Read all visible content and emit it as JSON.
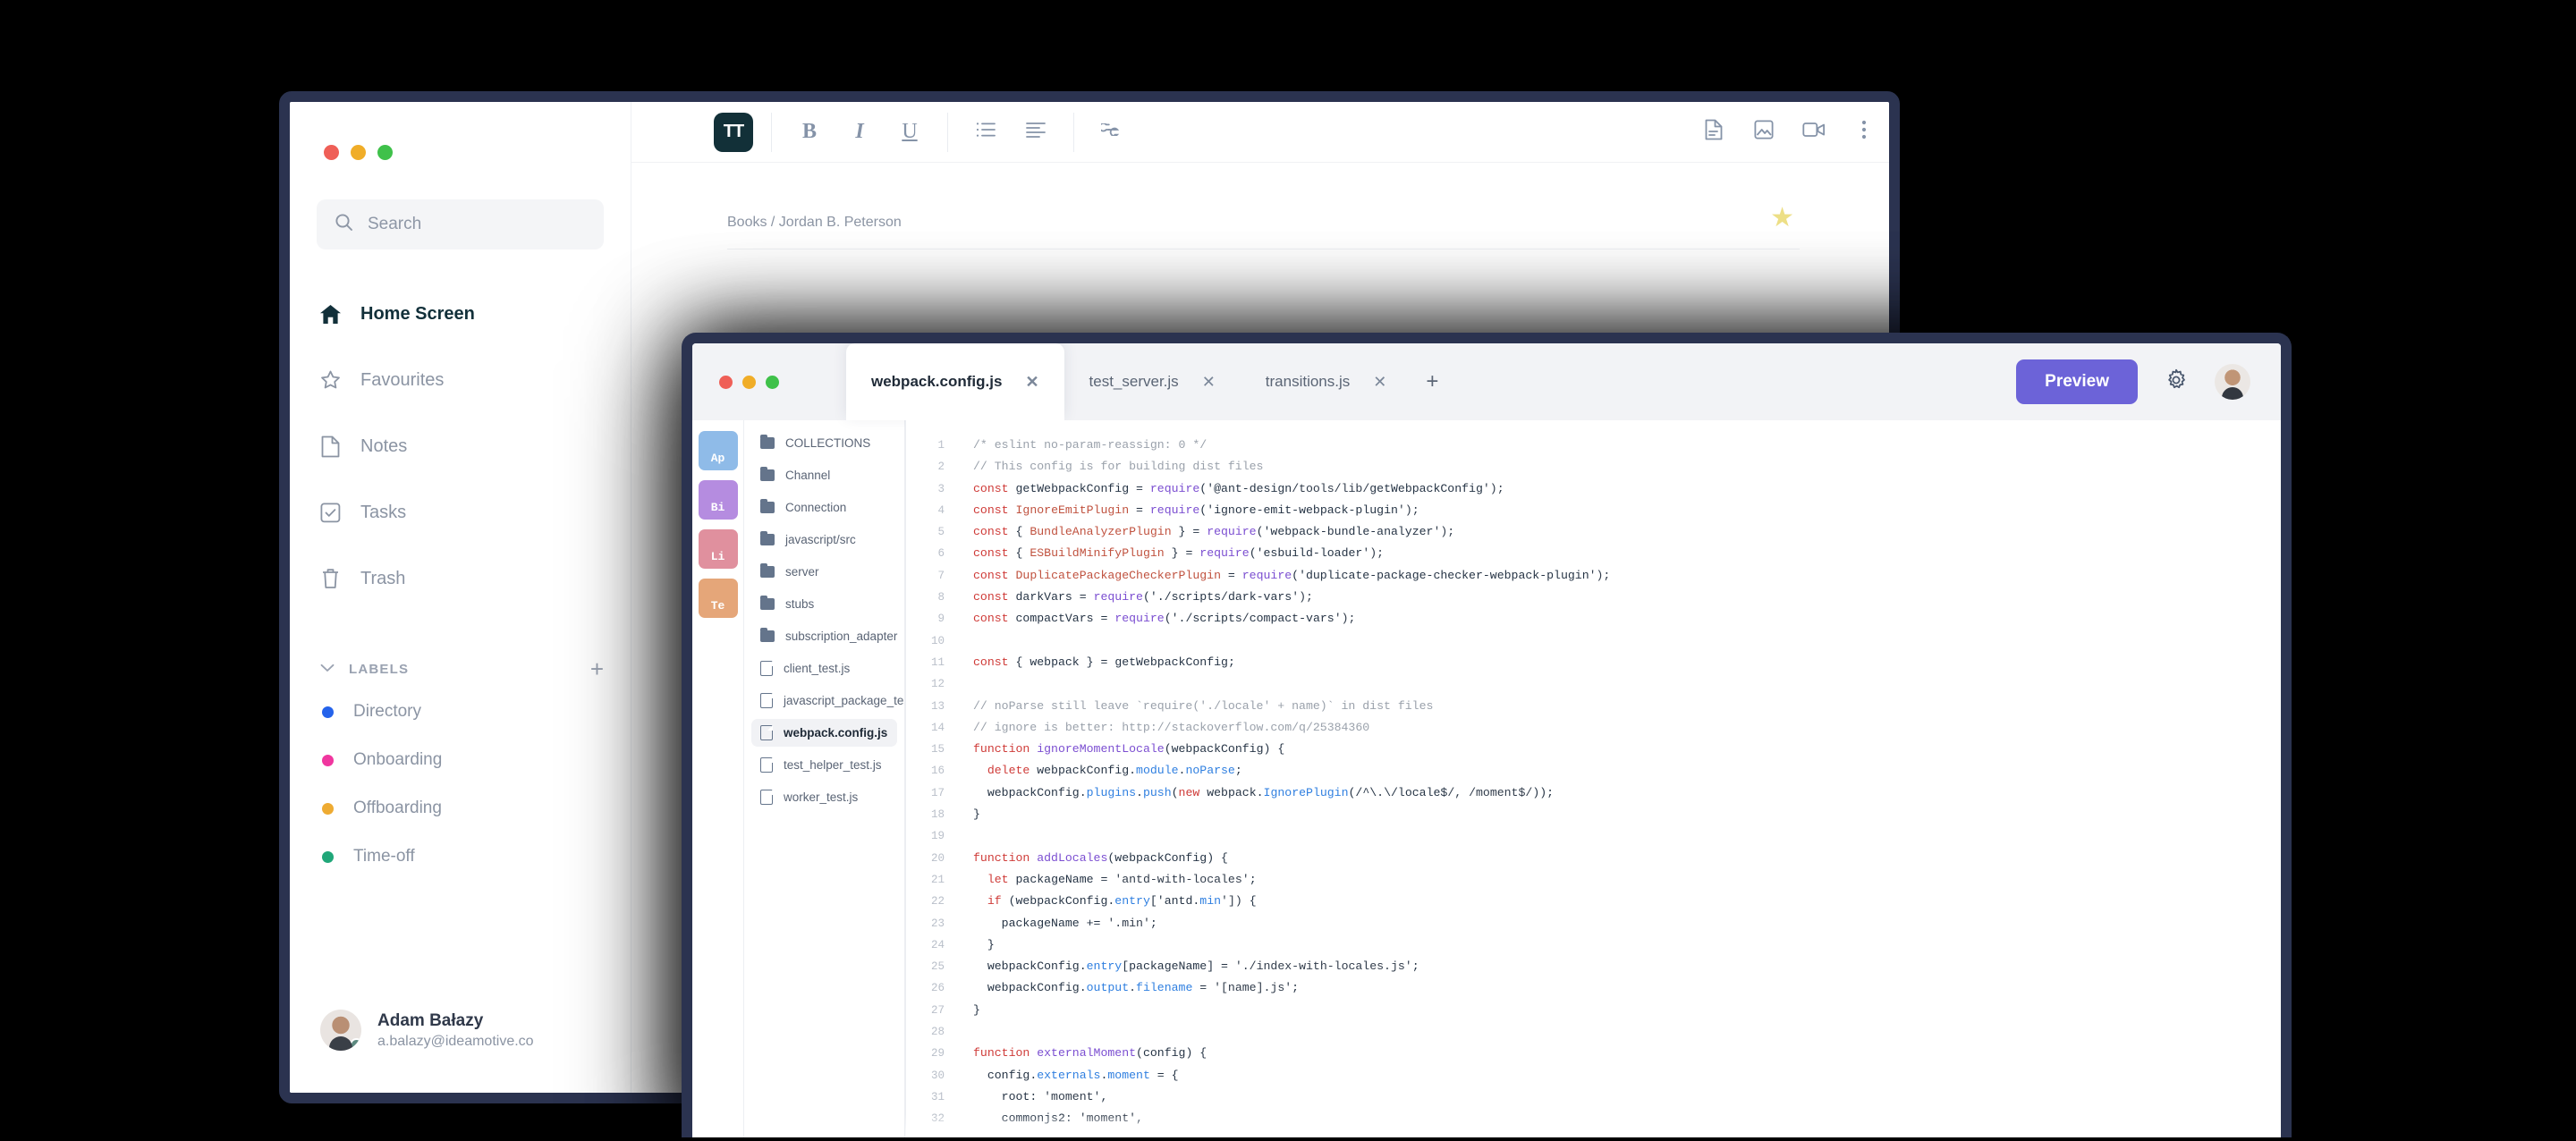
{
  "notes_app": {
    "window_controls": [
      "close",
      "minimize",
      "maximize"
    ],
    "search": {
      "placeholder": "Search",
      "icon": "search-icon"
    },
    "nav": [
      {
        "label": "Home Screen",
        "icon": "home-icon",
        "active": true
      },
      {
        "label": "Favourites",
        "icon": "star-icon",
        "active": false
      },
      {
        "label": "Notes",
        "icon": "file-icon",
        "active": false
      },
      {
        "label": "Tasks",
        "icon": "checkbox-icon",
        "active": false
      },
      {
        "label": "Trash",
        "icon": "trash-icon",
        "active": false
      }
    ],
    "labels_section": {
      "title": "LABELS",
      "collapse_icon": "chevron-down-icon",
      "add_icon": "plus-icon",
      "items": [
        {
          "label": "Directory",
          "color": "#2563eb"
        },
        {
          "label": "Onboarding",
          "color": "#f0369f"
        },
        {
          "label": "Offboarding",
          "color": "#eeab32"
        },
        {
          "label": "Time-off",
          "color": "#20a779"
        }
      ]
    },
    "user": {
      "name": "Adam Bałazy",
      "email": "a.balazy@ideamotive.co",
      "status": "online"
    },
    "toolbar": [
      {
        "name": "text-style-button",
        "label": "TT",
        "active": true
      },
      {
        "name": "bold-button",
        "label": "B"
      },
      {
        "name": "italic-button",
        "label": "I"
      },
      {
        "name": "underline-button",
        "label": "U"
      },
      {
        "name": "bullet-list-button",
        "label": "list"
      },
      {
        "name": "align-left-button",
        "label": "align"
      },
      {
        "name": "link-button",
        "label": "link"
      },
      {
        "name": "attach-document-button",
        "label": "doc"
      },
      {
        "name": "insert-image-button",
        "label": "image"
      },
      {
        "name": "insert-video-button",
        "label": "video"
      },
      {
        "name": "more-options-button",
        "label": "more"
      }
    ],
    "document": {
      "breadcrumb": "Books / Jordan B. Peterson",
      "favourite_icon": "star-filled-icon",
      "notification_icon": "bell-icon"
    }
  },
  "code_editor": {
    "window_controls": [
      "close",
      "minimize",
      "maximize"
    ],
    "tabs": [
      {
        "label": "webpack.config.js",
        "active": true,
        "close_icon": "close-icon"
      },
      {
        "label": "test_server.js",
        "active": false,
        "close_icon": "close-icon"
      },
      {
        "label": "transitions.js",
        "active": false,
        "close_icon": "close-icon"
      }
    ],
    "new_tab_icon": "plus-icon",
    "preview_button": "Preview",
    "settings_icon": "gear-icon",
    "avatar": "user-avatar",
    "accent_color": "#6c63d8",
    "rail": [
      {
        "label": "Ap",
        "color": "#8fbbe8"
      },
      {
        "label": "Bi",
        "color": "#b58ce0"
      },
      {
        "label": "Li",
        "color": "#e0909e"
      },
      {
        "label": "Te",
        "color": "#e5a679"
      }
    ],
    "file_tree": [
      {
        "label": "COLLECTIONS",
        "type": "folder",
        "selected": false
      },
      {
        "label": "Channel",
        "type": "folder",
        "selected": false
      },
      {
        "label": "Connection",
        "type": "folder",
        "selected": false
      },
      {
        "label": "javascript/src",
        "type": "folder",
        "selected": false
      },
      {
        "label": "server",
        "type": "folder",
        "selected": false
      },
      {
        "label": "stubs",
        "type": "folder",
        "selected": false
      },
      {
        "label": "subscription_adapter",
        "type": "folder",
        "selected": false
      },
      {
        "label": "client_test.js",
        "type": "file",
        "selected": false
      },
      {
        "label": "javascript_package_test.js",
        "type": "file",
        "selected": false
      },
      {
        "label": "webpack.config.js",
        "type": "file",
        "selected": true
      },
      {
        "label": "test_helper_test.js",
        "type": "file",
        "selected": false
      },
      {
        "label": "worker_test.js",
        "type": "file",
        "selected": false
      }
    ],
    "code": {
      "first_line_number": 1,
      "last_line_number": 32,
      "language": "javascript",
      "lines": [
        "/* eslint no-param-reassign: 0 */",
        "// This config is for building dist files",
        "const getWebpackConfig = require('@ant-design/tools/lib/getWebpackConfig');",
        "const IgnoreEmitPlugin = require('ignore-emit-webpack-plugin');",
        "const { BundleAnalyzerPlugin } = require('webpack-bundle-analyzer');",
        "const { ESBuildMinifyPlugin } = require('esbuild-loader');",
        "const DuplicatePackageCheckerPlugin = require('duplicate-package-checker-webpack-plugin');",
        "const darkVars = require('./scripts/dark-vars');",
        "const compactVars = require('./scripts/compact-vars');",
        "",
        "const { webpack } = getWebpackConfig;",
        "",
        "// noParse still leave `require('./locale' + name)` in dist files",
        "// ignore is better: http://stackoverflow.com/q/25384360",
        "function ignoreMomentLocale(webpackConfig) {",
        "  delete webpackConfig.module.noParse;",
        "  webpackConfig.plugins.push(new webpack.IgnorePlugin(/^\\.\\/locale$/, /moment$/));",
        "}",
        "",
        "function addLocales(webpackConfig) {",
        "  let packageName = 'antd-with-locales';",
        "  if (webpackConfig.entry['antd.min']) {",
        "    packageName += '.min';",
        "  }",
        "  webpackConfig.entry[packageName] = './index-with-locales.js';",
        "  webpackConfig.output.filename = '[name].js';",
        "}",
        "",
        "function externalMoment(config) {",
        "  config.externals.moment = {",
        "    root: 'moment',",
        "    commonjs2: 'moment',"
      ]
    }
  }
}
